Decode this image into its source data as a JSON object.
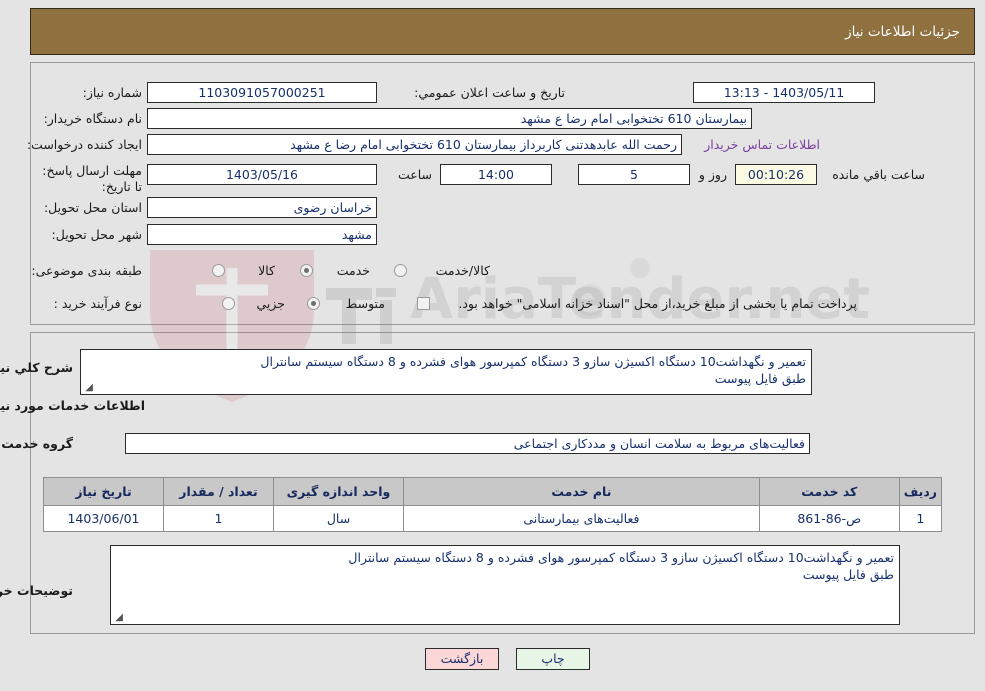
{
  "header": {
    "title": "جزئیات اطلاعات نیاز"
  },
  "need_info": {
    "need_number_label": "شماره نیاز:",
    "need_number_value": "1103091057000251",
    "buyer_org_label": "نام دستگاه خریدار:",
    "buyer_org_value": "بیمارستان 610 تختخوابی امام رضا ع  مشهد",
    "requester_label": "ایجاد کننده درخواست:",
    "requester_value": "رحمت الله عابدهدتنی کاربرداز بیمارستان 610 تختخوابی امام رضا ع  مشهد",
    "deadline_label": "مهلت ارسال پاسخ: تا تاریخ:",
    "deadline_date_value": "1403/05/16",
    "deadline_hour_label": "ساعت",
    "deadline_hour_value": "14:00",
    "days_value": "5",
    "days_label": "روز و",
    "countdown_value": "00:10:26",
    "countdown_label": "ساعت باقي مانده",
    "province_label": "استان محل تحویل:",
    "province_value": "خراسان رضوی",
    "city_label": "شهر محل تحویل:",
    "city_value": "مشهد",
    "announce_label": "تاریخ و ساعت اعلان عمومي:",
    "announce_value": "1403/05/11 - 13:13",
    "contact_link": "اطلاعات تماس خریدار",
    "category_label": "طبقه بندی موضوعی:",
    "category_options": [
      {
        "label": "کالا",
        "selected": false
      },
      {
        "label": "خدمت",
        "selected": true
      },
      {
        "label": "کالا/خدمت",
        "selected": false
      }
    ],
    "process_label": "نوع فرآیند خرید :",
    "process_options": [
      {
        "label": "جزیي",
        "selected": false
      },
      {
        "label": "متوسط",
        "selected": true
      }
    ],
    "treasury_checkbox_checked": false,
    "treasury_text": "پرداخت تمام یا بخشی از مبلغ خرید،از محل \"اسناد خزانه اسلامی\" خواهد بود."
  },
  "description": {
    "general_label": "شرح کلي نیاز:",
    "general_value": "تعمیر و نگهداشت10 دستگاه اکسیژن سازو 3 دستگاه کمپرسور هوای فشرده و 8 دستگاه سیستم سانترال\nطبق فایل پیوست",
    "section_title": "اطلاعات خدمات مورد نیاز",
    "service_group_label": "گروه خدمت:",
    "service_group_value": "فعالیت‌های مربوط به سلامت انسان و مددکاری اجتماعی",
    "buyer_notes_label": "توضیحات خریدار:",
    "buyer_notes_value": "تعمیر و نگهداشت10 دستگاه اکسیژن سازو 3 دستگاه کمپرسور هوای فشرده و 8 دستگاه سیستم سانترال\nطبق فایل پیوست"
  },
  "table": {
    "columns": [
      "ردیف",
      "کد خدمت",
      "نام خدمت",
      "واحد اندازه گیری",
      "تعداد / مقدار",
      "تاریخ نیاز"
    ],
    "rows": [
      [
        "1",
        "ص-86-861",
        "فعالیت‌های بیمارستانی",
        "سال",
        "1",
        "1403/06/01"
      ]
    ]
  },
  "footer": {
    "print_label": "چاپ",
    "back_label": "بازگشت"
  },
  "watermark": {
    "text": "AriaTender.net"
  },
  "colors": {
    "header_bg": "#8f7140",
    "page_bg": "#e4e4e4",
    "field_text": "#17306b",
    "link": "#7b3fa0",
    "table_header_bg": "#c8c8c8",
    "print_btn_bg": "#e8f6e8",
    "back_btn_bg": "#fbd7d7",
    "countdown_bg": "#fbfbe3"
  }
}
